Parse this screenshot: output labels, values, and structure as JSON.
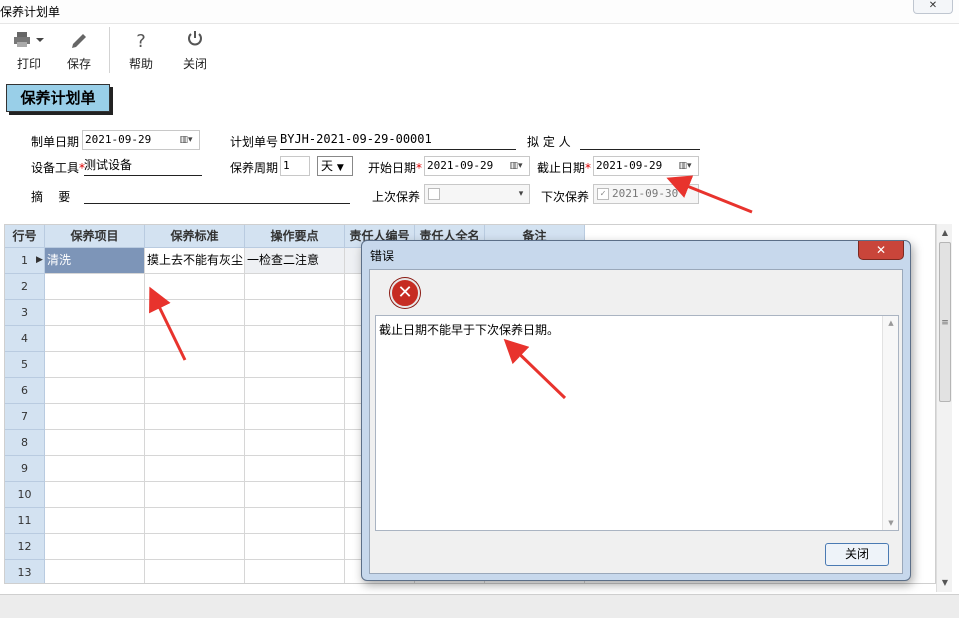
{
  "window": {
    "title": "保养计划单",
    "close_glyph": "✕"
  },
  "toolbar": {
    "print": {
      "label": "打印",
      "icon": "printer-icon"
    },
    "save": {
      "label": "保存",
      "icon": "pencil-icon"
    },
    "help": {
      "label": "帮助",
      "icon": "question-icon"
    },
    "close": {
      "label": "关闭",
      "icon": "power-icon"
    }
  },
  "form": {
    "title": "保养计划单",
    "created_date": {
      "label": "制单日期",
      "value": "2021-09-29"
    },
    "plan_no": {
      "label": "计划单号",
      "value": "BYJH-2021-09-29-00001"
    },
    "drafter": {
      "label": "拟 定 人",
      "value": ""
    },
    "equipment": {
      "label": "设备工具",
      "required_mark": "*",
      "value": "测试设备"
    },
    "cycle": {
      "label": "保养周期",
      "value": "1",
      "unit": "天"
    },
    "start_date": {
      "label": "开始日期",
      "required_mark": "*",
      "value": "2021-09-29"
    },
    "end_date": {
      "label": "截止日期",
      "required_mark": "*",
      "value": "2021-09-29"
    },
    "summary": {
      "label": "摘    要",
      "value": ""
    },
    "last_maint": {
      "label": "上次保养",
      "value": ""
    },
    "next_maint": {
      "label": "下次保养",
      "value": "2021-09-30",
      "checked": true
    }
  },
  "grid": {
    "columns": [
      "行号",
      "保养项目",
      "保养标准",
      "操作要点",
      "责任人编号",
      "责任人全名",
      "备注"
    ],
    "rows": [
      {
        "no": "1",
        "item": "清洗",
        "standard": "摸上去不能有灰尘",
        "point": "一检查二注意",
        "marker": "▶"
      },
      {
        "no": "2"
      },
      {
        "no": "3"
      },
      {
        "no": "4"
      },
      {
        "no": "5"
      },
      {
        "no": "6"
      },
      {
        "no": "7"
      },
      {
        "no": "8"
      },
      {
        "no": "9"
      },
      {
        "no": "10"
      },
      {
        "no": "11"
      },
      {
        "no": "12"
      },
      {
        "no": "13"
      }
    ]
  },
  "dialog": {
    "title": "错误",
    "close_glyph": "✕",
    "icon": "error-icon",
    "message": "截止日期不能早于下次保养日期。",
    "ok_label": "关闭"
  },
  "annotation_color": "#e8332d"
}
